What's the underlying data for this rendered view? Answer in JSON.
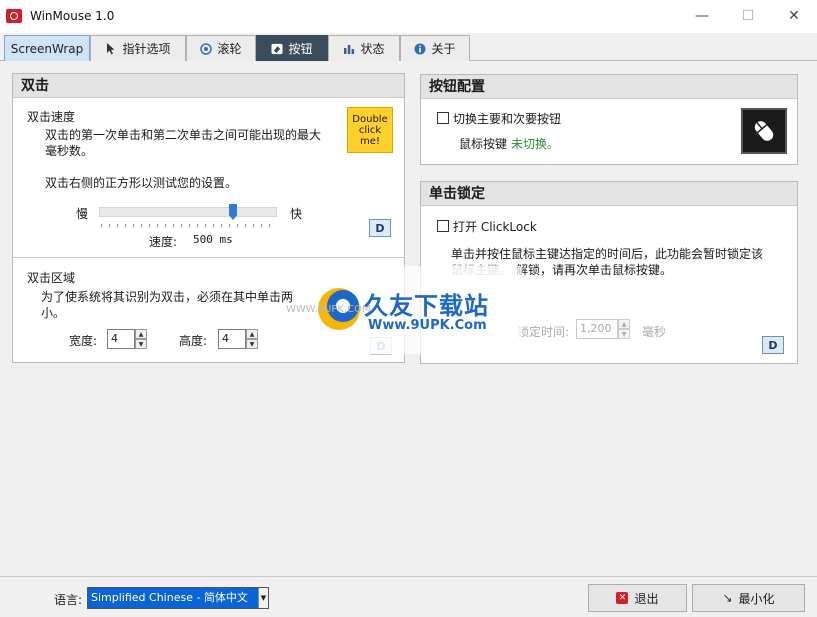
{
  "window": {
    "title": "WinMouse 1.0",
    "minimize": "—",
    "maximize": "☐",
    "close": "✕"
  },
  "tabs": [
    {
      "label": "ScreenWrap",
      "icon": ""
    },
    {
      "label": "指针选项",
      "icon": "pointer-icon"
    },
    {
      "label": "滚轮",
      "icon": "wheel-icon"
    },
    {
      "label": "按钮",
      "icon": "button-icon"
    },
    {
      "label": "状态",
      "icon": "bar-chart-icon"
    },
    {
      "label": "关于",
      "icon": "info-icon"
    }
  ],
  "doubleclick": {
    "title": "双击",
    "speed_title": "双击速度",
    "speed_desc_line1": "双击的第一次单击和第二次单击之间可能出现的最大",
    "speed_desc_line2": "毫秒数。",
    "test_desc": "双击右侧的正方形以测试您的设置。",
    "test_box_line1": "Double",
    "test_box_line2": "click",
    "test_box_line3": "me!",
    "slow": "慢",
    "fast": "快",
    "speed_label": "速度:",
    "speed_value": "500 ms",
    "slider_fraction": 0.76,
    "default_button": "D",
    "area_title": "双击区域",
    "area_desc_line1": "为了使系统将其识别为双击，必须在其中单击两",
    "area_desc_line2": "小。",
    "width_label": "宽度:",
    "width_value": "4",
    "height_label": "高度:",
    "height_value": "4",
    "area_default_button": "D"
  },
  "buttonconfig": {
    "title": "按钮配置",
    "swap_label": "切换主要和次要按钮",
    "status_prefix": "鼠标按键",
    "status_value": "未切换。",
    "status_color": "#2e8b3a"
  },
  "clicklock": {
    "title": "单击锁定",
    "enable_label": "打开 ClickLock",
    "desc_line1": "单击并按住鼠标主键达指定的时间后，此功能会暂时锁定该",
    "desc_line2_a": "鼠标主键。",
    "desc_line2_b": "解锁，请再次单击鼠标按键。",
    "time_label": "锁定时间:",
    "time_value": "1,200",
    "time_unit": "毫秒",
    "default_button": "D"
  },
  "watermark": {
    "brand": "久友下载站",
    "url": "Www.9UPK.Com",
    "small_url": "WWW.9UPK.COM"
  },
  "footer": {
    "language_label": "语言:",
    "language_value": "Simplified Chinese  -  简体中文",
    "exit_label": "退出",
    "minimize_label": "最小化"
  }
}
